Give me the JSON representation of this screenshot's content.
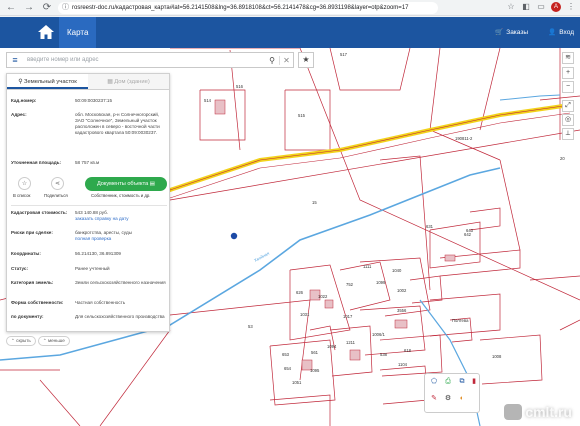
{
  "browser": {
    "url": "rosreestr-doc.ru/кадастровая_карта#lat=56.2141508&lng=36.8918108&ct=56.2141478&cg=36.8931198&layer=otp&zoom=17",
    "profile_initial": "А"
  },
  "header": {
    "tab_label": "Карта",
    "order_label": "Заказы",
    "login_label": "Вход"
  },
  "search": {
    "placeholder": "введите номер или адрес"
  },
  "panel": {
    "tabs": [
      {
        "label": "Земельный участок",
        "active": true
      },
      {
        "label": "Дом (здание)",
        "active": false
      }
    ],
    "fields": {
      "cad_num_label": "Кад.номер:",
      "cad_num_value": "50:09:0030237:15",
      "address_label": "Адрес:",
      "address_value": "обл. Московская, р-н Солнечногорский, ЗАО \"Солнечное\", Земельный участок расположен в северо - восточной части кадастрового квартала 50:09:0030237.",
      "area_label": "Уточненная площадь:",
      "area_value": "58 757 кв.м",
      "cost_label": "Кадастровая стоимость:",
      "cost_value": "543 140.88 руб.",
      "cost_link": "заказать справку на дату",
      "risk_label": "Риски при сделке:",
      "risk_value": "банкротства, аресты, суды",
      "risk_link": "полная проверка",
      "coords_label": "Координаты:",
      "coords_value": "56.214130, 36.891309",
      "status_label": "Статус:",
      "status_value": "Ранее учтенный",
      "category_label": "Категория земель:",
      "category_value": "Земли сельскохозяйственного назначения",
      "ownership_label": "Форма собственности:",
      "ownership_value": "Частная собственность",
      "usage_label": "по документу:",
      "usage_value": "Для сельскохозяйственного производства"
    },
    "actions": {
      "list_label": "В список",
      "share_label": "Поделиться",
      "object_button": "Документы объекта",
      "object_sub": "Собственник, стоимость и др."
    },
    "collapse": {
      "hide_label": "скрыть",
      "less_label": "меньше"
    }
  },
  "map": {
    "labels": [
      "517",
      "515",
      "514",
      "516",
      "53",
      "Хвойная",
      "15",
      "1111",
      "1040",
      "1099",
      "752",
      "1002",
      "626",
      "1022",
      "1031",
      "3556",
      "1006/1",
      "1017",
      "643",
      "Полтева",
      "653",
      "561",
      "1104",
      "1051",
      "654",
      "1095",
      "1094",
      "190811-2",
      "642",
      "631",
      "618",
      "1211",
      "538",
      "1008",
      "20"
    ],
    "highlight_color": "#f2d31b",
    "parcel_stroke": "#c0283a",
    "road_color": "#5ba7e0"
  },
  "watermark": "cmlt.ru"
}
